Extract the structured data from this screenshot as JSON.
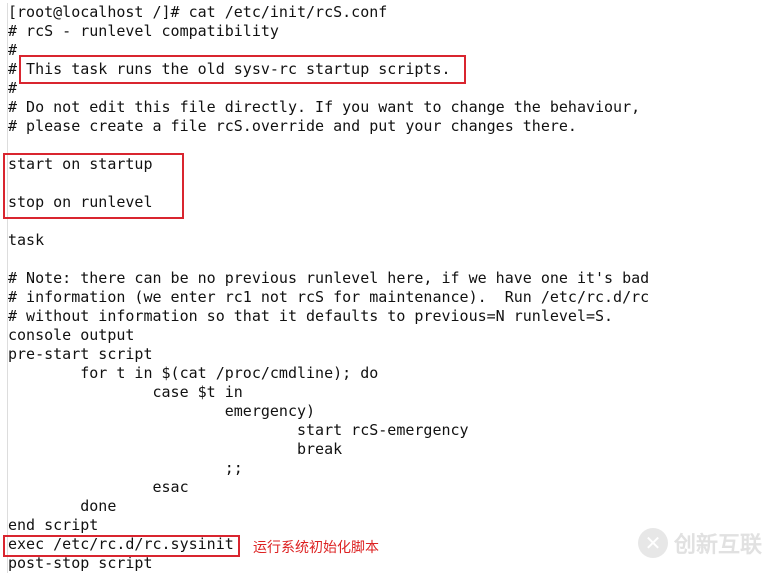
{
  "terminal": {
    "lines": [
      "[root@localhost /]# cat /etc/init/rcS.conf",
      "# rcS - runlevel compatibility",
      "#",
      "# This task runs the old sysv-rc startup scripts.",
      "#",
      "# Do not edit this file directly. If you want to change the behaviour,",
      "# please create a file rcS.override and put your changes there.",
      "",
      "start on startup",
      "",
      "stop on runlevel",
      "",
      "task",
      "",
      "# Note: there can be no previous runlevel here, if we have one it's bad",
      "# information (we enter rc1 not rcS for maintenance).  Run /etc/rc.d/rc",
      "# without information so that it defaults to previous=N runlevel=S.",
      "console output",
      "pre-start script",
      "        for t in $(cat /proc/cmdline); do",
      "                case $t in",
      "                        emergency)",
      "                                start rcS-emergency",
      "                                break",
      "                        ;;",
      "                esac",
      "        done",
      "end script",
      "exec /etc/rc.d/rc.sysinit",
      "post-stop script"
    ]
  },
  "annotation": {
    "text": "运行系统初始化脚本",
    "color": "#d9252f"
  },
  "watermark": {
    "text": "创新互联"
  }
}
